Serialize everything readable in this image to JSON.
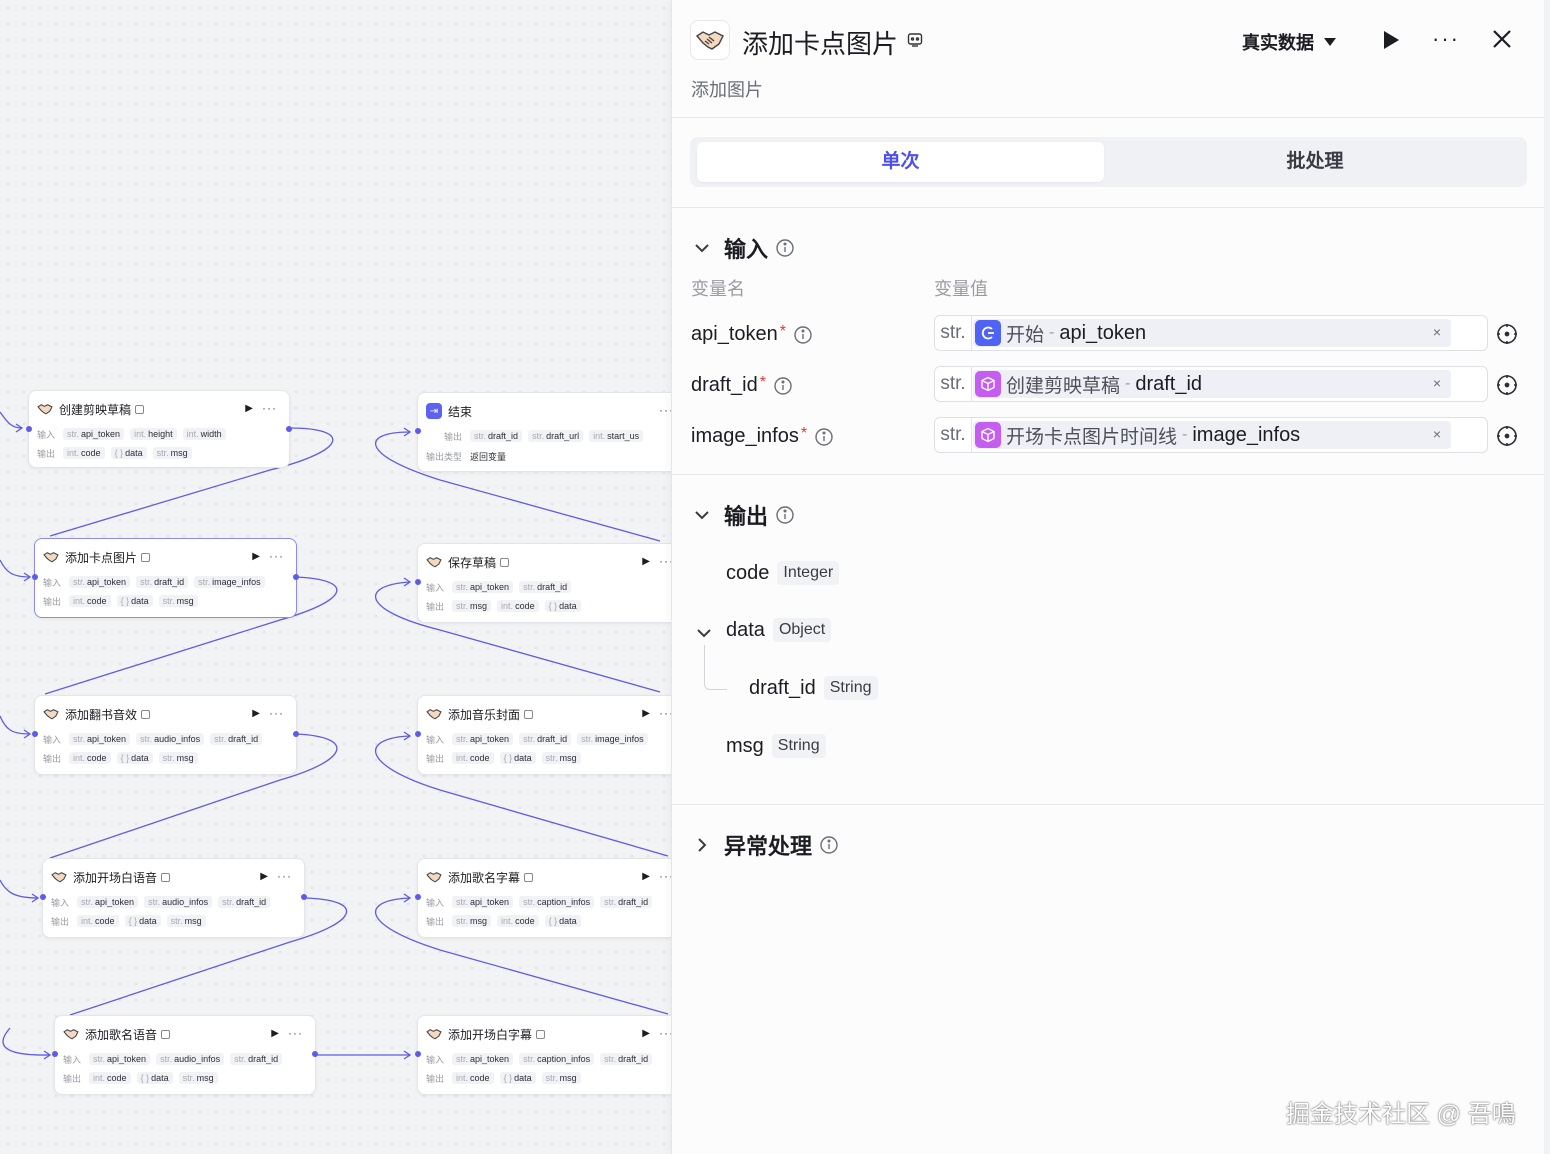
{
  "canvas": {
    "nodes": [
      {
        "id": "n1",
        "title": "创建剪映草稿",
        "inputs": [
          [
            "str.",
            "api_token"
          ],
          [
            "int.",
            "height"
          ],
          [
            "int.",
            "width"
          ]
        ],
        "outputs": [
          [
            "int.",
            "code"
          ],
          [
            "{ }",
            "data"
          ],
          [
            "str.",
            "msg"
          ]
        ]
      },
      {
        "id": "n2",
        "title": "添加卡点图片",
        "inputs": [
          [
            "str.",
            "api_token"
          ],
          [
            "str.",
            "draft_id"
          ],
          [
            "str.",
            "image_infos"
          ]
        ],
        "outputs": [
          [
            "int.",
            "code"
          ],
          [
            "{ }",
            "data"
          ],
          [
            "str.",
            "msg"
          ]
        ]
      },
      {
        "id": "n3",
        "title": "添加翻书音效",
        "inputs": [
          [
            "str.",
            "api_token"
          ],
          [
            "str.",
            "audio_infos"
          ],
          [
            "str.",
            "draft_id"
          ]
        ],
        "outputs": [
          [
            "int.",
            "code"
          ],
          [
            "{ }",
            "data"
          ],
          [
            "str.",
            "msg"
          ]
        ]
      },
      {
        "id": "n4",
        "title": "添加开场白语音",
        "inputs": [
          [
            "str.",
            "api_token"
          ],
          [
            "str.",
            "audio_infos"
          ],
          [
            "str.",
            "draft_id"
          ]
        ],
        "outputs": [
          [
            "int.",
            "code"
          ],
          [
            "{ }",
            "data"
          ],
          [
            "str.",
            "msg"
          ]
        ]
      },
      {
        "id": "n5",
        "title": "添加歌名语音",
        "inputs": [
          [
            "str.",
            "api_token"
          ],
          [
            "str.",
            "audio_infos"
          ],
          [
            "str.",
            "draft_id"
          ]
        ],
        "outputs": [
          [
            "int.",
            "code"
          ],
          [
            "{ }",
            "data"
          ],
          [
            "str.",
            "msg"
          ]
        ]
      },
      {
        "id": "n6",
        "title": "结束",
        "inputs": [
          [
            "str.",
            "draft_id"
          ],
          [
            "str.",
            "draft_url"
          ],
          [
            "int.",
            "start_us"
          ]
        ],
        "outputs": [],
        "ret_label": "返回变量"
      },
      {
        "id": "n7",
        "title": "保存草稿",
        "inputs": [
          [
            "str.",
            "api_token"
          ],
          [
            "str.",
            "draft_id"
          ]
        ],
        "outputs": [
          [
            "str.",
            "msg"
          ],
          [
            "int.",
            "code"
          ],
          [
            "{ }",
            "data"
          ]
        ]
      },
      {
        "id": "n8",
        "title": "添加音乐封面",
        "inputs": [
          [
            "str.",
            "api_token"
          ],
          [
            "str.",
            "draft_id"
          ],
          [
            "str.",
            "image_infos"
          ]
        ],
        "outputs": [
          [
            "int.",
            "code"
          ],
          [
            "{ }",
            "data"
          ],
          [
            "str.",
            "msg"
          ]
        ]
      },
      {
        "id": "n9",
        "title": "添加歌名字幕",
        "inputs": [
          [
            "str.",
            "api_token"
          ],
          [
            "str.",
            "caption_infos"
          ],
          [
            "str.",
            "draft_id"
          ]
        ],
        "outputs": [
          [
            "str.",
            "msg"
          ],
          [
            "int.",
            "code"
          ],
          [
            "{ }",
            "data"
          ]
        ]
      },
      {
        "id": "n10",
        "title": "添加开场白字幕",
        "inputs": [
          [
            "str.",
            "api_token"
          ],
          [
            "str.",
            "caption_infos"
          ],
          [
            "str.",
            "draft_id"
          ]
        ],
        "outputs": [
          [
            "int.",
            "code"
          ],
          [
            "{ }",
            "data"
          ],
          [
            "str.",
            "msg"
          ]
        ]
      }
    ],
    "labels": {
      "input": "输入",
      "output": "输出",
      "end_output": "输出",
      "end_output_type": "输出类型",
      "run": "▶",
      "more": "···"
    }
  },
  "panel": {
    "title": "添加卡点图片",
    "subtitle": "添加图片",
    "mode_label": "真实数据",
    "more": "···",
    "tabs": {
      "single": "单次",
      "batch": "批处理"
    },
    "input_section": {
      "title": "输入",
      "col_name": "变量名",
      "col_value": "变量值",
      "rows": [
        {
          "name": "api_token",
          "required": "*",
          "type": "str.",
          "ref_node": "开始",
          "sep": "-",
          "ref_var": "api_token",
          "icon_color": "#4f63f5",
          "clear": "×"
        },
        {
          "name": "draft_id",
          "required": "*",
          "type": "str.",
          "ref_node": "创建剪映草稿",
          "sep": "-",
          "ref_var": "draft_id",
          "icon_color": "#c45df0",
          "clear": "×"
        },
        {
          "name": "image_infos",
          "required": "*",
          "type": "str.",
          "ref_node": "开场卡点图片时间线",
          "sep": "-",
          "ref_var": "image_infos",
          "icon_color": "#c45df0",
          "clear": "×"
        }
      ]
    },
    "output_section": {
      "title": "输出",
      "rows": [
        {
          "name": "code",
          "type": "Integer"
        },
        {
          "name": "data",
          "type": "Object"
        },
        {
          "name": "draft_id",
          "type": "String"
        },
        {
          "name": "msg",
          "type": "String"
        }
      ]
    },
    "error_section": {
      "title": "异常处理"
    }
  },
  "watermark": "掘金技术社区 @ 吾鳴",
  "colors": {
    "accent": "#4f4ef0",
    "edge": "#5e5ce6",
    "required": "#e6372e",
    "plugin_purple": "#c45df0",
    "start_blue": "#4f63f5"
  }
}
